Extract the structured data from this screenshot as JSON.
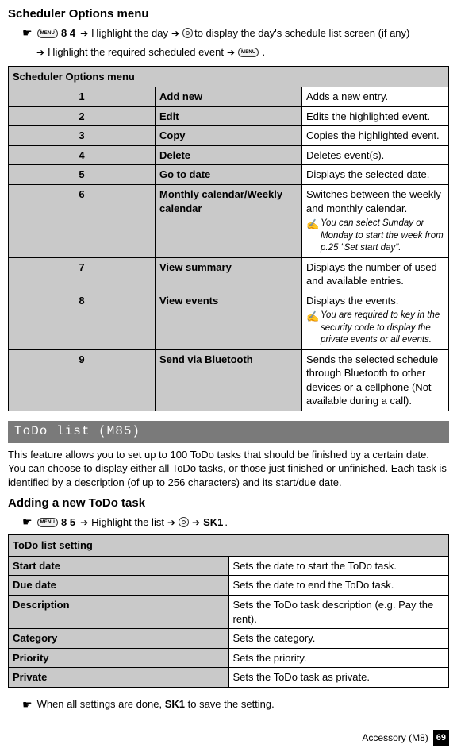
{
  "heading1": "Scheduler Options menu",
  "instr1": {
    "keys1": "8 4",
    "text1": "Highlight the day",
    "text2": "to display the day's schedule list screen (if any)",
    "text3": "Highlight the required scheduled event",
    "period": "."
  },
  "opts_table": {
    "title": "Scheduler Options menu",
    "rows": [
      {
        "n": "1",
        "opt": "Add new",
        "desc": "Adds a new entry."
      },
      {
        "n": "2",
        "opt": "Edit",
        "desc": "Edits the highlighted event."
      },
      {
        "n": "3",
        "opt": "Copy",
        "desc": "Copies the highlighted event."
      },
      {
        "n": "4",
        "opt": "Delete",
        "desc": "Deletes event(s)."
      },
      {
        "n": "5",
        "opt": "Go to date",
        "desc": "Displays the selected date."
      },
      {
        "n": "6",
        "opt": "Monthly calendar/Weekly calendar",
        "desc": "Switches between the weekly and monthly calendar.",
        "note": "You can select Sunday or Monday to start the week from p.25 \"Set start day\"."
      },
      {
        "n": "7",
        "opt": "View summary",
        "desc": "Displays the number of used and available entries."
      },
      {
        "n": "8",
        "opt": "View events",
        "desc": "Displays the events.",
        "note": "You are required to key in the security code to display the private events or all events."
      },
      {
        "n": "9",
        "opt": "Send via Bluetooth",
        "desc": "Sends the selected schedule through Bluetooth to other devices or a cellphone (Not available during a call)."
      }
    ]
  },
  "banner": "ToDo list (M85)",
  "todo_intro": "This feature allows you to set up to 100 ToDo tasks that should be finished by a certain date. You can choose to display either all ToDo tasks, or those just finished or unfinished. Each task is identified by a description (of up to 256 characters) and its start/due date.",
  "heading2": "Adding a new ToDo task",
  "instr2": {
    "keys1": "8 5",
    "text1": "Highlight the list",
    "sk1": "SK1",
    "period": "."
  },
  "todo_table": {
    "title": "ToDo list setting",
    "rows": [
      {
        "opt": "Start date",
        "desc": "Sets the date to start the ToDo task."
      },
      {
        "opt": "Due date",
        "desc": "Sets the date to end the ToDo task."
      },
      {
        "opt": "Description",
        "desc": "Sets the ToDo task description (e.g. Pay the rent)."
      },
      {
        "opt": "Category",
        "desc": "Sets the category."
      },
      {
        "opt": "Priority",
        "desc": "Sets the priority."
      },
      {
        "opt": "Private",
        "desc": "Sets the ToDo task as private."
      }
    ]
  },
  "final_note": {
    "pre": "When all settings are done, ",
    "sk1": "SK1",
    "post": " to save the setting."
  },
  "footer": {
    "section": "Accessory (M8)",
    "page": "69"
  },
  "glyphs": {
    "menu": "MENU",
    "note_marker": "✍"
  }
}
